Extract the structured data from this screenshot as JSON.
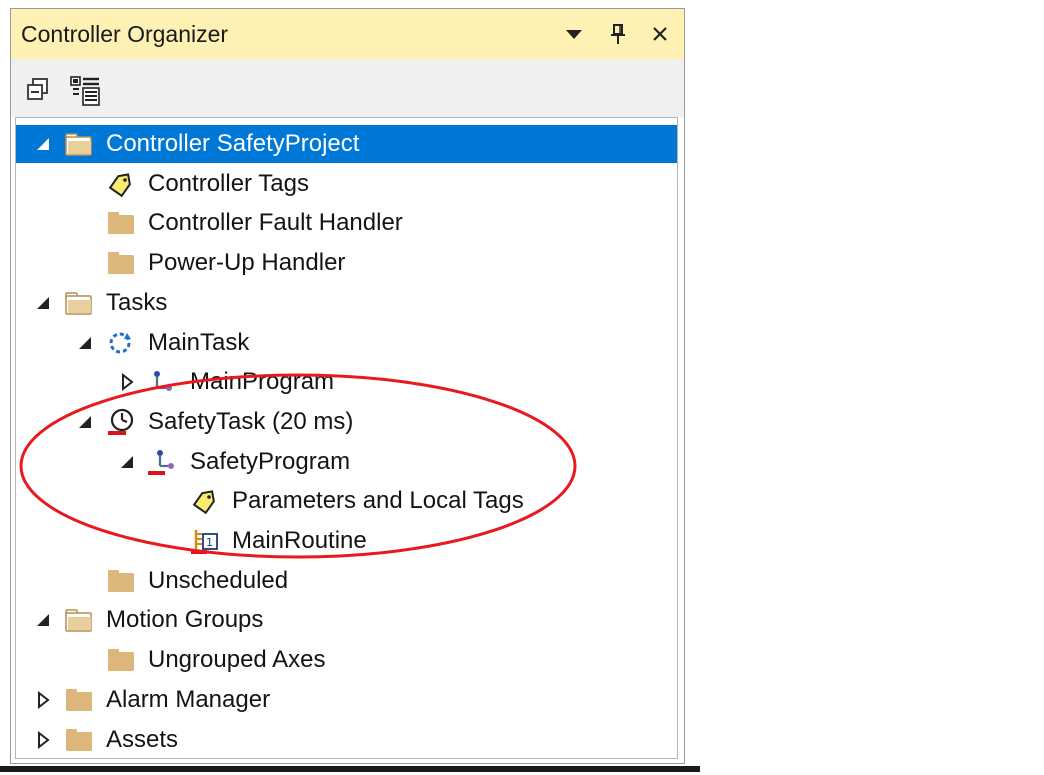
{
  "window": {
    "title": "Controller Organizer",
    "buttons": {
      "dropdown": "▼",
      "pin": "📌",
      "close": "✕"
    }
  },
  "toolbar": {
    "tools": [
      {
        "icon": "collapse-all-icon"
      },
      {
        "icon": "properties-view-icon"
      }
    ]
  },
  "tree": {
    "items": [
      {
        "label": "Controller SafetyProject",
        "level": 0,
        "expand": "expanded",
        "icon": "controller-folder-icon",
        "selected": true
      },
      {
        "label": "Controller Tags",
        "level": 1,
        "expand": "none",
        "icon": "tag-icon"
      },
      {
        "label": "Controller Fault Handler",
        "level": 1,
        "expand": "none",
        "icon": "folder-icon"
      },
      {
        "label": "Power-Up Handler",
        "level": 1,
        "expand": "none",
        "icon": "folder-icon"
      },
      {
        "label": "Tasks",
        "level": 0,
        "expand": "expanded",
        "icon": "open-folder-icon"
      },
      {
        "label": "MainTask",
        "level": 1,
        "expand": "expanded",
        "icon": "continuous-task-icon"
      },
      {
        "label": "MainProgram",
        "level": 2,
        "expand": "collapsed",
        "icon": "program-icon"
      },
      {
        "label": "SafetyTask (20 ms)",
        "level": 1,
        "expand": "expanded",
        "icon": "safety-periodic-task-icon"
      },
      {
        "label": "SafetyProgram",
        "level": 2,
        "expand": "expanded",
        "icon": "safety-program-icon"
      },
      {
        "label": "Parameters and Local Tags",
        "level": 3,
        "expand": "none",
        "icon": "tag-icon"
      },
      {
        "label": "MainRoutine",
        "level": 3,
        "expand": "none",
        "icon": "safety-routine-icon"
      },
      {
        "label": "Unscheduled",
        "level": 1,
        "expand": "none",
        "icon": "folder-icon"
      },
      {
        "label": "Motion Groups",
        "level": 0,
        "expand": "expanded",
        "icon": "open-folder-icon"
      },
      {
        "label": "Ungrouped Axes",
        "level": 1,
        "expand": "none",
        "icon": "folder-icon"
      },
      {
        "label": "Alarm Manager",
        "level": 0,
        "expand": "collapsed",
        "icon": "folder-icon"
      },
      {
        "label": "Assets",
        "level": 0,
        "expand": "collapsed",
        "icon": "folder-icon"
      }
    ]
  },
  "colors": {
    "title_bg": "#fdf2b3",
    "selection": "#0078d7",
    "annotation": "#e8191f",
    "folder": "#dcb67a",
    "safety_red": "#d8141a"
  }
}
